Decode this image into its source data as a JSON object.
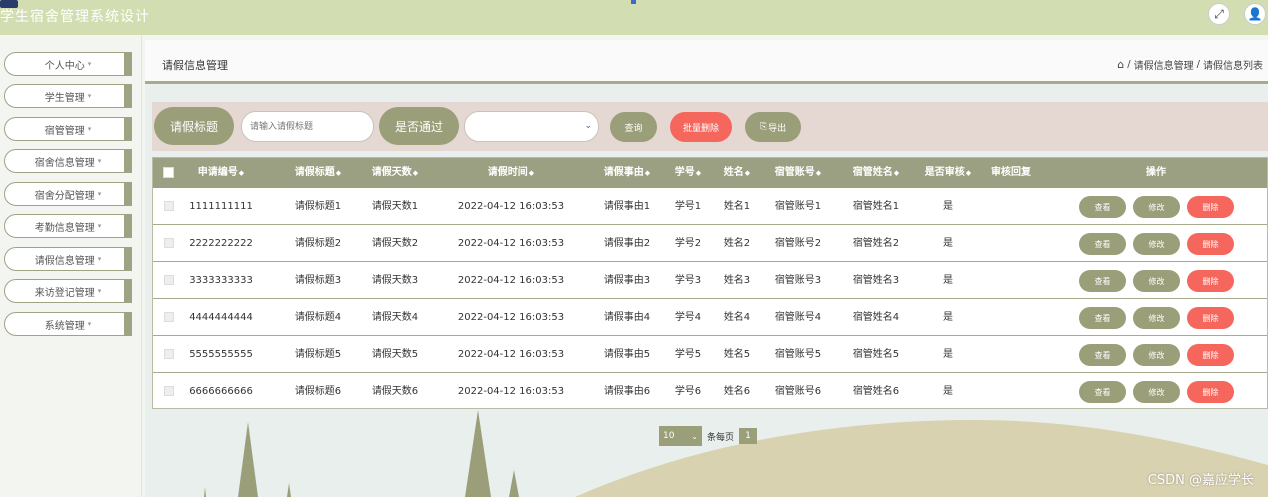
{
  "app": {
    "title": "学生宿舍管理系统设计",
    "fullscreen_icon": "expand-icon",
    "user_icon": "user-icon"
  },
  "sidebar": {
    "items": [
      {
        "label": "个人中心",
        "caret": "▾"
      },
      {
        "label": "学生管理",
        "caret": "▾"
      },
      {
        "label": "宿管管理",
        "caret": "▾"
      },
      {
        "label": "宿舍信息管理",
        "caret": "▾"
      },
      {
        "label": "宿舍分配管理",
        "caret": "▾"
      },
      {
        "label": "考勤信息管理",
        "caret": "▾"
      },
      {
        "label": "请假信息管理",
        "caret": "▾"
      },
      {
        "label": "来访登记管理",
        "caret": "▾"
      },
      {
        "label": "系统管理",
        "caret": "▾"
      }
    ]
  },
  "page": {
    "title": "请假信息管理",
    "breadcrumb": [
      "请假信息管理",
      "请假信息列表"
    ],
    "breadcrumb_sep": "/"
  },
  "search": {
    "title_chip": "请假标题",
    "title_placeholder": "请输入请假标题",
    "pass_chip": "是否通过",
    "select_value": "",
    "query_label": "查询",
    "batch_delete_label": "批量删除",
    "export_label": "导出"
  },
  "table": {
    "columns": [
      {
        "label": "申请编号",
        "sortable": true
      },
      {
        "label": "请假标题",
        "sortable": true
      },
      {
        "label": "请假天数",
        "sortable": true
      },
      {
        "label": "请假时间",
        "sortable": true
      },
      {
        "label": "请假事由",
        "sortable": true
      },
      {
        "label": "学号",
        "sortable": true
      },
      {
        "label": "姓名",
        "sortable": true
      },
      {
        "label": "宿管账号",
        "sortable": true
      },
      {
        "label": "宿管姓名",
        "sortable": true
      },
      {
        "label": "是否审核",
        "sortable": true
      },
      {
        "label": "审核回复",
        "sortable": false
      },
      {
        "label": "操作",
        "sortable": false
      }
    ],
    "sort_glyph": "◆",
    "rows": [
      {
        "id": "1111111111",
        "title": "请假标题1",
        "days": "请假天数1",
        "time": "2022-04-12 16:03:53",
        "reason": "请假事由1",
        "student_no": "学号1",
        "name": "姓名1",
        "admin_account": "宿管账号1",
        "admin_name": "宿管姓名1",
        "reviewed": "是",
        "reply": ""
      },
      {
        "id": "2222222222",
        "title": "请假标题2",
        "days": "请假天数2",
        "time": "2022-04-12 16:03:53",
        "reason": "请假事由2",
        "student_no": "学号2",
        "name": "姓名2",
        "admin_account": "宿管账号2",
        "admin_name": "宿管姓名2",
        "reviewed": "是",
        "reply": ""
      },
      {
        "id": "3333333333",
        "title": "请假标题3",
        "days": "请假天数3",
        "time": "2022-04-12 16:03:53",
        "reason": "请假事由3",
        "student_no": "学号3",
        "name": "姓名3",
        "admin_account": "宿管账号3",
        "admin_name": "宿管姓名3",
        "reviewed": "是",
        "reply": ""
      },
      {
        "id": "4444444444",
        "title": "请假标题4",
        "days": "请假天数4",
        "time": "2022-04-12 16:03:53",
        "reason": "请假事由4",
        "student_no": "学号4",
        "name": "姓名4",
        "admin_account": "宿管账号4",
        "admin_name": "宿管姓名4",
        "reviewed": "是",
        "reply": ""
      },
      {
        "id": "5555555555",
        "title": "请假标题5",
        "days": "请假天数5",
        "time": "2022-04-12 16:03:53",
        "reason": "请假事由5",
        "student_no": "学号5",
        "name": "姓名5",
        "admin_account": "宿管账号5",
        "admin_name": "宿管姓名5",
        "reviewed": "是",
        "reply": ""
      },
      {
        "id": "6666666666",
        "title": "请假标题6",
        "days": "请假天数6",
        "time": "2022-04-12 16:03:53",
        "reason": "请假事由6",
        "student_no": "学号6",
        "name": "姓名6",
        "admin_account": "宿管账号6",
        "admin_name": "宿管姓名6",
        "reviewed": "是",
        "reply": ""
      }
    ],
    "actions": {
      "view": "查看",
      "edit": "修改",
      "delete": "删除"
    }
  },
  "pagination": {
    "page_size": "10",
    "per_page_label": "条每页",
    "current_page": "1"
  },
  "watermark": "CSDN @嘉应学长",
  "colors": {
    "header_bg": "#d3ddb2",
    "accent": "#9a9e79",
    "danger": "#f5665d",
    "search_bg": "#e5d8d2"
  }
}
